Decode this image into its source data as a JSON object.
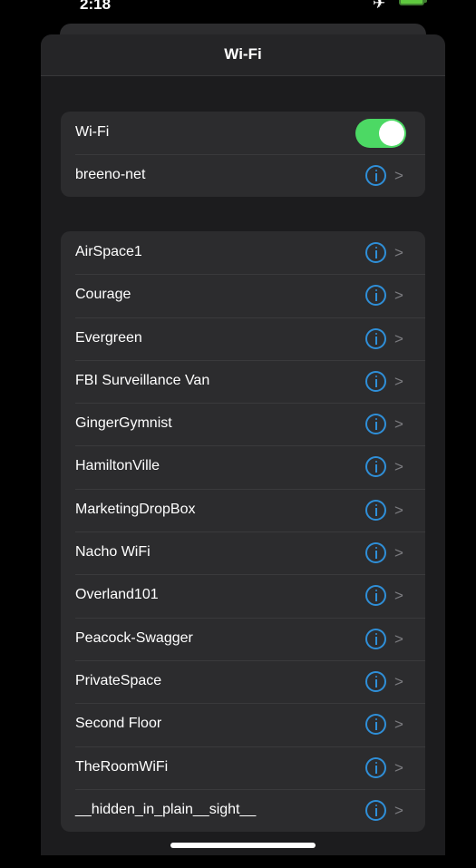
{
  "status_bar": {
    "time": "2:18",
    "airplane_icon": "airplane-icon",
    "battery_icon": "battery-icon",
    "battery_color": "#5fc93f"
  },
  "header": {
    "title": "Wi-Fi"
  },
  "wifi": {
    "label": "Wi-Fi",
    "enabled": true,
    "toggle_color": "#4cd964",
    "connected_network": "breeno-net"
  },
  "networks": [
    "AirSpace1",
    "Courage",
    "Evergreen",
    "FBI Surveillance Van",
    "GingerGymnist",
    "HamiltonVille",
    "MarketingDropBox",
    "Nacho WiFi",
    "Overland101",
    "Peacock-Swagger",
    "PrivateSpace",
    "Second Floor",
    "TheRoomWiFi",
    "__hidden_in_plain__sight__"
  ],
  "colors": {
    "accent": "#2f8fd8",
    "background": "#1c1c1e",
    "cell": "#2c2c2e"
  }
}
